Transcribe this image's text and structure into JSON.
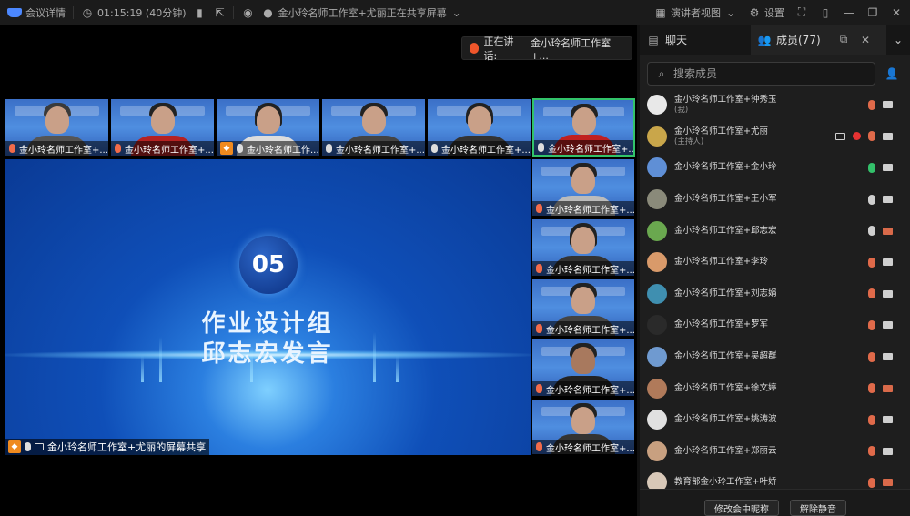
{
  "topbar": {
    "meeting_details": "会议详情",
    "duration": "01:15:19 (40分钟)",
    "sharing_status": "金小玲名师工作室+尤丽正在共享屏幕",
    "speaker_view": "演讲者视图",
    "settings": "设置"
  },
  "stage": {
    "speaking_label": "正在讲话:",
    "speaking_name": "金小玲名师工作室+...",
    "top_row": [
      {
        "label": "金小玲名师工作室+...",
        "mic": "off"
      },
      {
        "label": "金小玲名师工作室+...",
        "mic": "off"
      },
      {
        "label": "金小玲名师工作...",
        "mic": "on",
        "host_badge": true
      },
      {
        "label": "金小玲名师工作室+...",
        "mic": "on"
      },
      {
        "label": "金小玲名师工作室+...",
        "mic": "on"
      },
      {
        "label": "金小玲名师工作室+...",
        "mic": "on",
        "active": true
      }
    ],
    "side_column": [
      {
        "label": "金小玲名师工作室+..."
      },
      {
        "label": "金小玲名师工作室+..."
      },
      {
        "label": "金小玲名师工作室+..."
      },
      {
        "label": "金小玲名师工作室+..."
      },
      {
        "label": "金小玲名师工作室+..."
      }
    ],
    "share": {
      "number": "05",
      "title_line1": "作业设计组",
      "title_line2": "邱志宏发言",
      "caption": "金小玲名师工作室+尤丽的屏幕共享"
    }
  },
  "panel": {
    "chat_tab": "聊天",
    "members_tab": "成员(77)",
    "search_placeholder": "搜索成员",
    "members": [
      {
        "name": "金小玲名师工作室+钟秀玉",
        "role": "(我)",
        "mic": "off",
        "cam": "on",
        "color": "#e8e8e8"
      },
      {
        "name": "金小玲名师工作室+尤丽",
        "role": "(主持人)",
        "mic": "off",
        "cam": "on",
        "screen": true,
        "rec": true,
        "color": "#c9a64a"
      },
      {
        "name": "金小玲名师工作室+金小玲",
        "role": "",
        "mic": "on",
        "cam": "on",
        "color": "#5f8fd6"
      },
      {
        "name": "金小玲名师工作室+王小军",
        "role": "",
        "mic": "muted",
        "cam": "on",
        "color": "#8a8a7a"
      },
      {
        "name": "金小玲名师工作室+邱志宏",
        "role": "",
        "mic": "muted",
        "cam": "off",
        "color": "#6aa84f"
      },
      {
        "name": "金小玲名师工作室+李玲",
        "role": "",
        "mic": "off",
        "cam": "on",
        "color": "#d99a6a"
      },
      {
        "name": "金小玲名师工作室+刘志娟",
        "role": "",
        "mic": "off",
        "cam": "on",
        "color": "#3f8fb0"
      },
      {
        "name": "金小玲名师工作室+罗军",
        "role": "",
        "mic": "off",
        "cam": "on",
        "color": "#2a2a2a"
      },
      {
        "name": "金小玲名师工作室+吴超群",
        "role": "",
        "mic": "off",
        "cam": "on",
        "color": "#6f9ad0"
      },
      {
        "name": "金小玲名师工作室+徐文婷",
        "role": "",
        "mic": "off",
        "cam": "off",
        "color": "#b07a5a"
      },
      {
        "name": "金小玲名师工作室+姚涛波",
        "role": "",
        "mic": "off",
        "cam": "on",
        "color": "#e0e0e0"
      },
      {
        "name": "金小玲名师工作室+郑丽云",
        "role": "",
        "mic": "off",
        "cam": "on",
        "color": "#c8a080"
      },
      {
        "name": "教育部金小玲工作室+叶娇",
        "role": "",
        "mic": "off",
        "cam": "off",
        "color": "#d8c8b8"
      }
    ],
    "rename_btn": "修改会中昵称",
    "unmute_btn": "解除静音"
  }
}
